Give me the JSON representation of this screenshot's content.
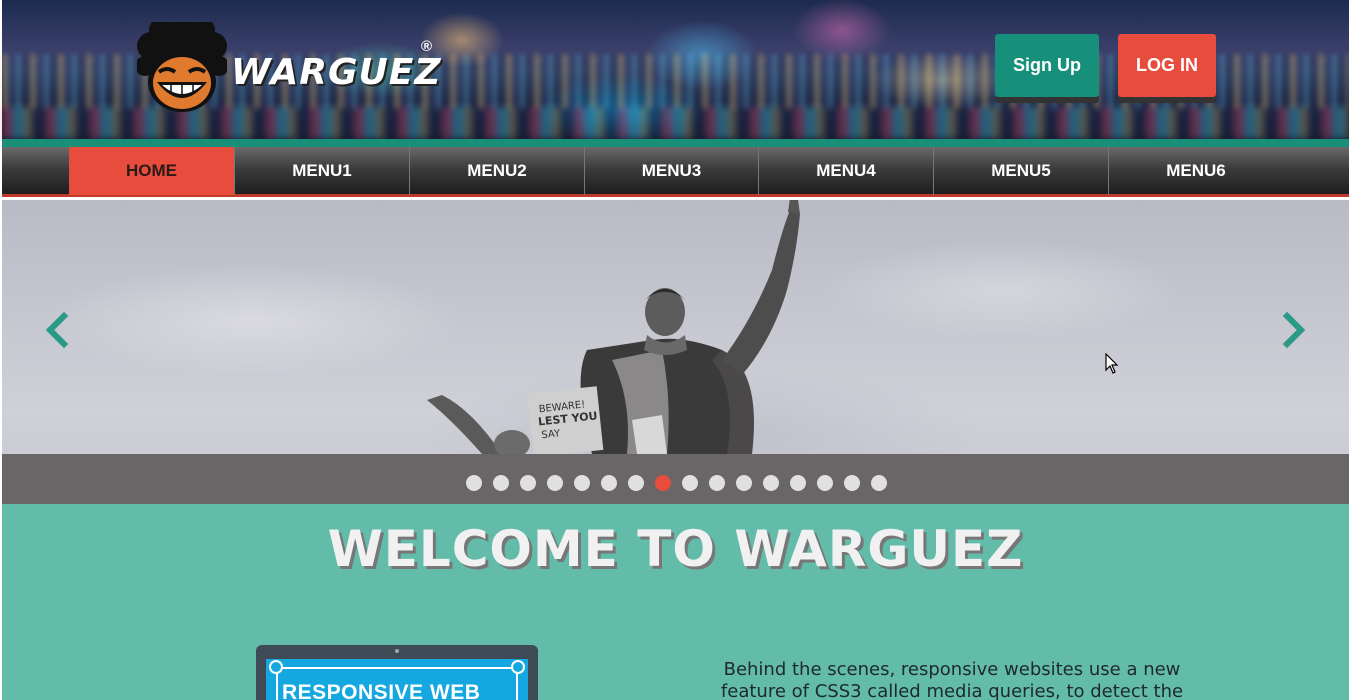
{
  "header": {
    "brand": "WARGUEZ",
    "brand_mark": "®",
    "signup_label": "Sign Up",
    "login_label": "LOG IN"
  },
  "nav": {
    "items": [
      {
        "label": "HOME",
        "active": true
      },
      {
        "label": "MENU1"
      },
      {
        "label": "MENU2"
      },
      {
        "label": "MENU3"
      },
      {
        "label": "MENU4"
      },
      {
        "label": "MENU5"
      },
      {
        "label": "MENU6"
      }
    ]
  },
  "slider": {
    "prev_icon": "chevron-left-icon",
    "next_icon": "chevron-right-icon",
    "slide_count": 16,
    "active_slide": 8,
    "image_sign_text": [
      "BEWARE!",
      "LEST YOU",
      "SAY"
    ]
  },
  "welcome": {
    "title": "WELCOME TO WARGUEZ",
    "device_label": "RESPONSIVE WEB",
    "intro_line1": "Behind the scenes, responsive websites use a new",
    "intro_line2": "feature of CSS3 called media queries, to detect the"
  },
  "colors": {
    "accent_red": "#e84c3d",
    "accent_teal": "#16907a",
    "welcome_bg": "#63bba9",
    "nav_dark": "#2a2a2a"
  }
}
